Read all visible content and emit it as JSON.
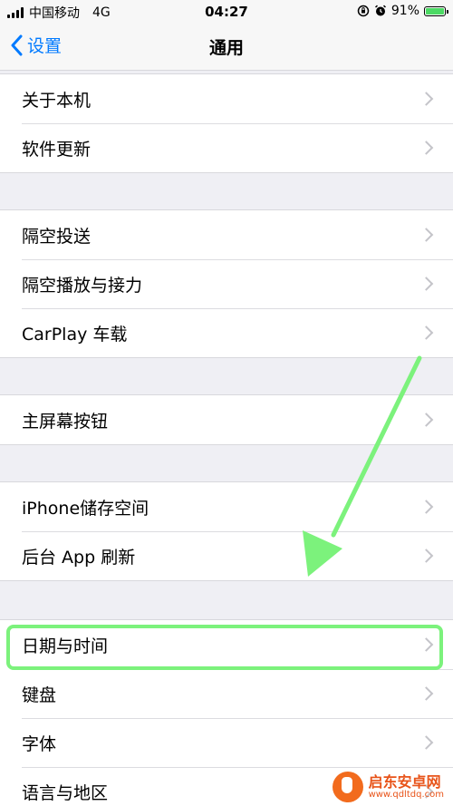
{
  "status_bar": {
    "carrier": "中国移动",
    "network": "4G",
    "time": "04:27",
    "battery": "91%"
  },
  "nav": {
    "back_label": "设置",
    "title": "通用"
  },
  "groups": [
    {
      "items": [
        "关于本机",
        "软件更新"
      ]
    },
    {
      "items": [
        "隔空投送",
        "隔空播放与接力",
        "CarPlay 车载"
      ]
    },
    {
      "items": [
        "主屏幕按钮"
      ]
    },
    {
      "items": [
        "iPhone储存空间",
        "后台 App 刷新"
      ]
    },
    {
      "items": [
        "日期与时间",
        "键盘",
        "字体",
        "语言与地区"
      ]
    }
  ],
  "annotation": {
    "arrow_color": "#7cf27c",
    "highlight_color": "#7cf27c",
    "highlighted_item": "日期与时间"
  },
  "watermark": {
    "name": "启东安卓网",
    "url": "www.qdltdq.com"
  },
  "colors": {
    "accent": "#007aff",
    "background": "#efeff4",
    "battery": "#4cd964"
  }
}
